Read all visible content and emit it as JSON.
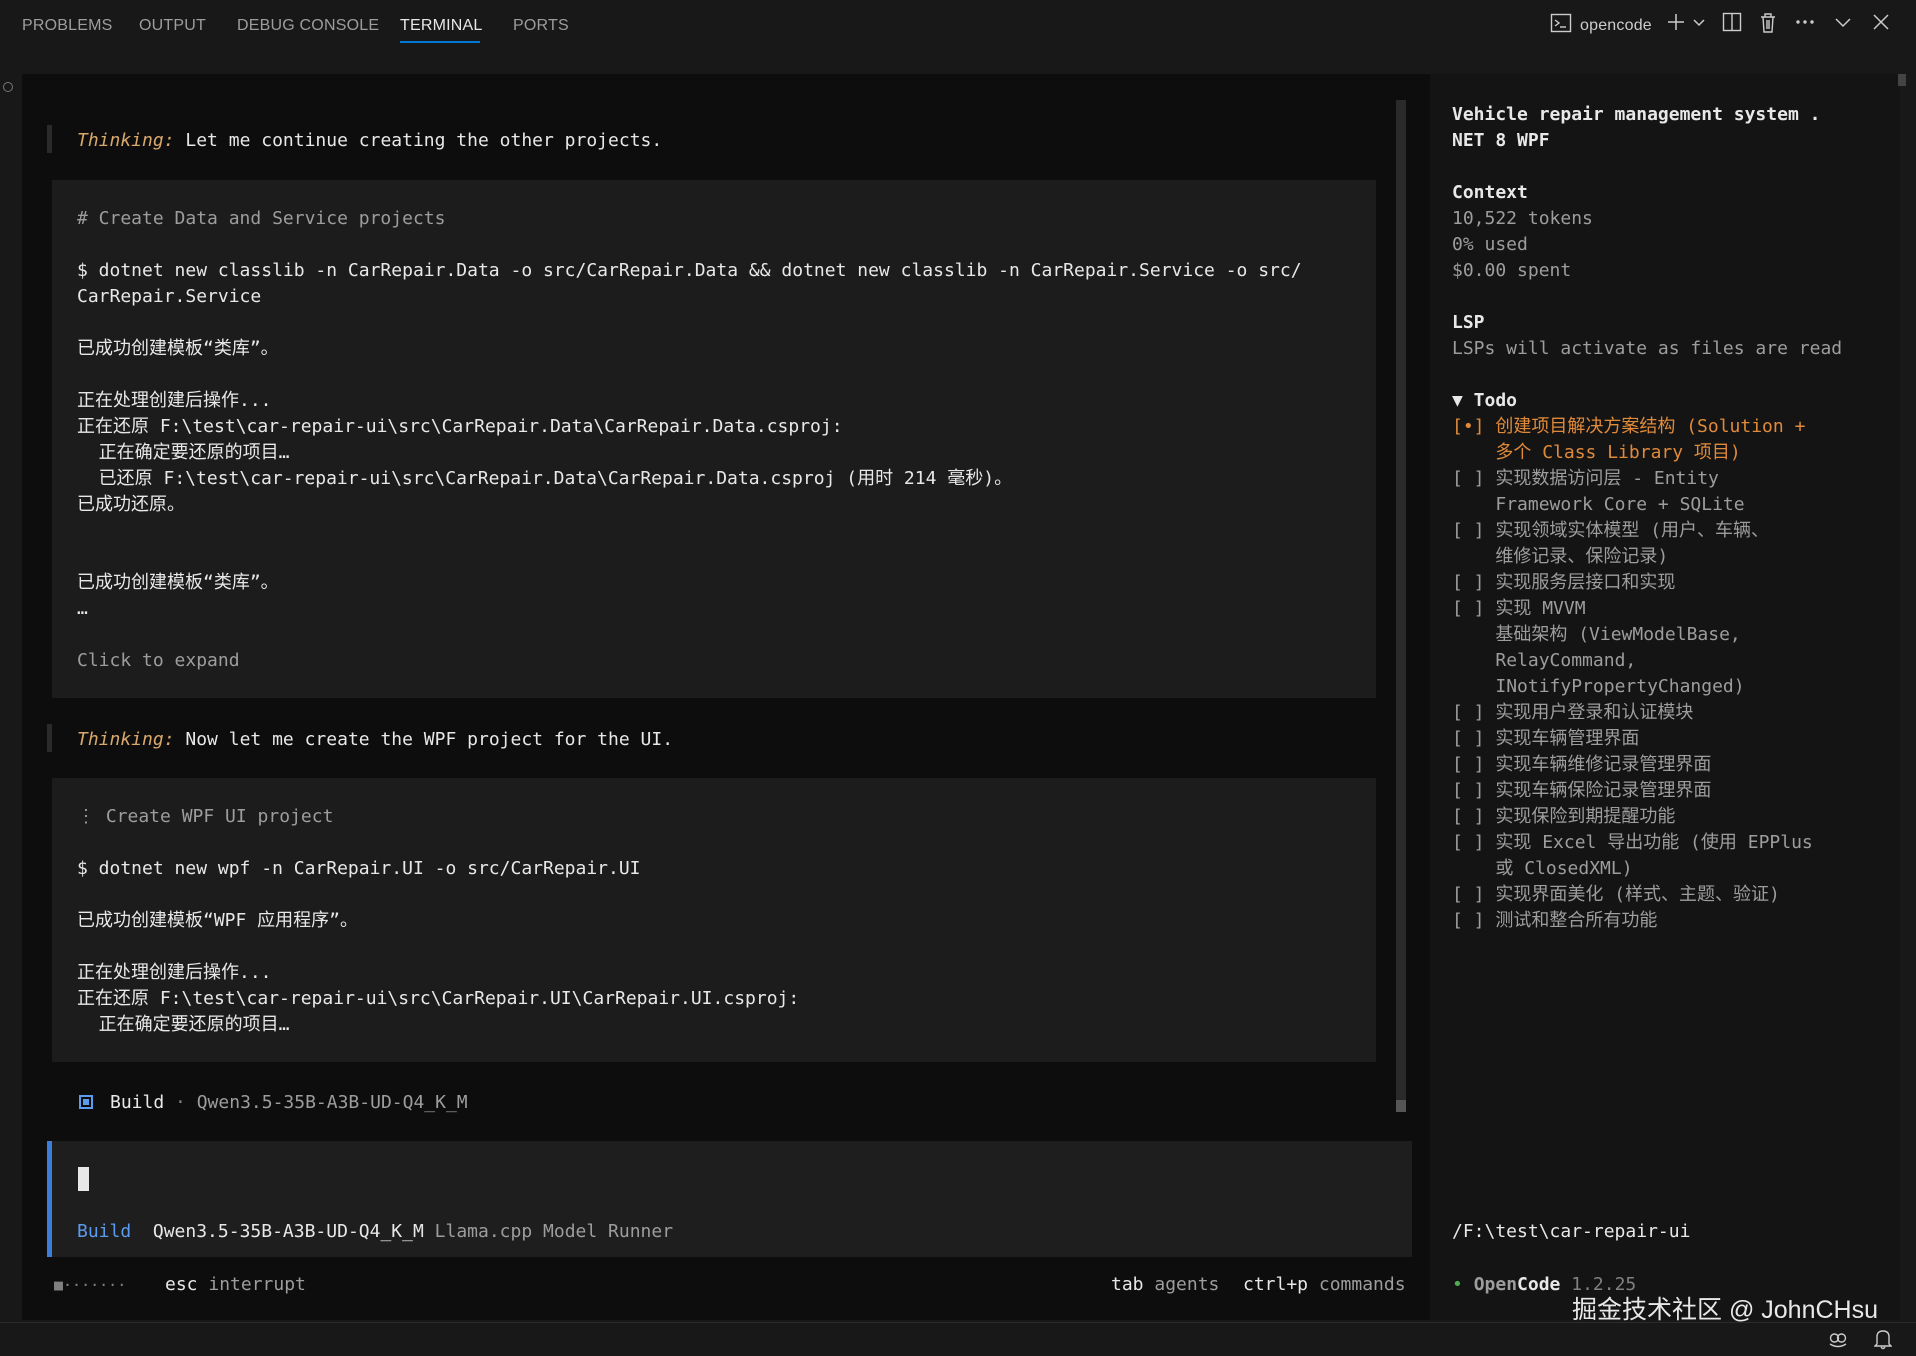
{
  "panel": {
    "tabs": [
      "PROBLEMS",
      "OUTPUT",
      "DEBUG CONSOLE",
      "TERMINAL",
      "PORTS"
    ],
    "active_tab": "TERMINAL",
    "terminal_name": "opencode",
    "icons": [
      "terminal-icon",
      "plus-icon",
      "chevron-down-icon",
      "split-icon",
      "trash-icon",
      "more-icon",
      "chevron-down-icon",
      "close-icon"
    ]
  },
  "conversation": {
    "thinking1": {
      "label": "Thinking:",
      "text": " Let me continue creating the other projects."
    },
    "block1": {
      "comment": "# Create Data and Service projects",
      "command_l1": "$ dotnet new classlib -n CarRepair.Data -o src/CarRepair.Data && dotnet new classlib -n CarRepair.Service -o src/",
      "command_l2": "CarRepair.Service",
      "out1": "已成功创建模板“类库”。",
      "out2": "正在处理创建后操作...",
      "out3": "正在还原 F:\\test\\car-repair-ui\\src\\CarRepair.Data\\CarRepair.Data.csproj:",
      "out4": "  正在确定要还原的项目…",
      "out5": "  已还原 F:\\test\\car-repair-ui\\src\\CarRepair.Data\\CarRepair.Data.csproj (用时 214 毫秒)。",
      "out6": "已成功还原。",
      "out7": "已成功创建模板“类库”。",
      "out8": "…",
      "expand": "Click to expand"
    },
    "thinking2": {
      "label": "Thinking:",
      "text": " Now let me create the WPF project for the UI."
    },
    "block2": {
      "comment": "⋮ Create WPF UI project",
      "command": "$ dotnet new wpf -n CarRepair.UI -o src/CarRepair.UI",
      "out1": "已成功创建模板“WPF 应用程序”。",
      "out2": "正在处理创建后操作...",
      "out3": "正在还原 F:\\test\\car-repair-ui\\src\\CarRepair.UI\\CarRepair.UI.csproj:",
      "out4": "  正在确定要还原的项目…"
    },
    "status": {
      "mode": "Build",
      "sep": "·",
      "model": "Qwen3.5-35B-A3B-UD-Q4_K_M"
    }
  },
  "input": {
    "mode": "Build",
    "model": "Qwen3.5-35B-A3B-UD-Q4_K_M",
    "provider": "Llama.cpp Model Runner"
  },
  "footer": {
    "spinner": "■·······",
    "esc_key": "esc",
    "esc_label": "interrupt",
    "tab_key": "tab",
    "tab_label": "agents",
    "cmd_key": "ctrl+p",
    "cmd_label": "commands"
  },
  "sidebar": {
    "title_l1": "Vehicle repair management system .",
    "title_l2": "NET 8 WPF",
    "context_heading": "Context",
    "tokens": "10,522 tokens",
    "used": "0% used",
    "spent": "$0.00 spent",
    "lsp_heading": "LSP",
    "lsp_text": "LSPs will activate as files are read",
    "todo_heading": "▼ Todo",
    "todos": [
      {
        "mark": "[•]",
        "lines": [
          "创建项目解决方案结构 (Solution +",
          "多个 Class Library 项目)"
        ],
        "active": true
      },
      {
        "mark": "[ ]",
        "lines": [
          "实现数据访问层 - Entity",
          "Framework Core + SQLite"
        ],
        "active": false
      },
      {
        "mark": "[ ]",
        "lines": [
          "实现领域实体模型 (用户、车辆、",
          "维修记录、保险记录)"
        ],
        "active": false
      },
      {
        "mark": "[ ]",
        "lines": [
          "实现服务层接口和实现"
        ],
        "active": false
      },
      {
        "mark": "[ ]",
        "lines": [
          "实现 MVVM",
          "基础架构 (ViewModelBase,",
          "RelayCommand,",
          "INotifyPropertyChanged)"
        ],
        "active": false
      },
      {
        "mark": "[ ]",
        "lines": [
          "实现用户登录和认证模块"
        ],
        "active": false
      },
      {
        "mark": "[ ]",
        "lines": [
          "实现车辆管理界面"
        ],
        "active": false
      },
      {
        "mark": "[ ]",
        "lines": [
          "实现车辆维修记录管理界面"
        ],
        "active": false
      },
      {
        "mark": "[ ]",
        "lines": [
          "实现车辆保险记录管理界面"
        ],
        "active": false
      },
      {
        "mark": "[ ]",
        "lines": [
          "实现保险到期提醒功能"
        ],
        "active": false
      },
      {
        "mark": "[ ]",
        "lines": [
          "实现 Excel 导出功能 (使用 EPPlus",
          "或 ClosedXML)"
        ],
        "active": false
      },
      {
        "mark": "[ ]",
        "lines": [
          "实现界面美化 (样式、主题、验证)"
        ],
        "active": false
      },
      {
        "mark": "[ ]",
        "lines": [
          "测试和整合所有功能"
        ],
        "active": false
      }
    ],
    "path": "/F:\\test\\car-repair-ui",
    "brand_dot": "•",
    "brand_a": "Open",
    "brand_b": "Code",
    "version": "1.2.25"
  },
  "watermark": "掘金技术社区 @ JohnCHsu",
  "colors": {
    "accent": "#0078d4",
    "build_blue": "#5b9bf0",
    "todo_active": "#e08a3a",
    "thinking": "#d9a86c"
  }
}
